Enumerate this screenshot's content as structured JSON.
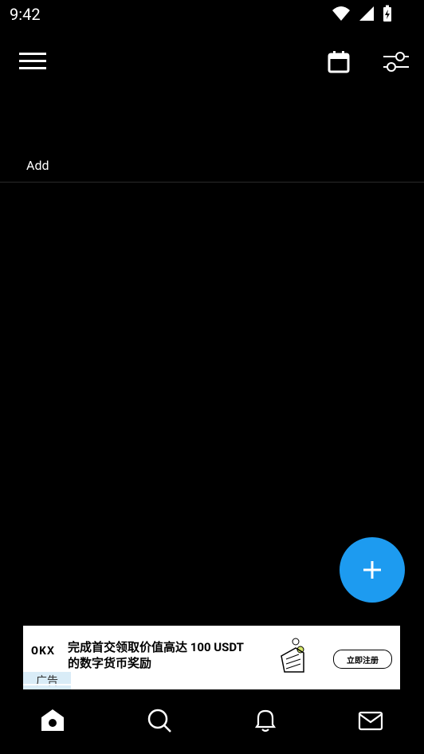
{
  "status_bar": {
    "time": "9:42",
    "icons": [
      "wifi-icon",
      "signal-icon",
      "battery-charging-icon"
    ]
  },
  "top_bar": {
    "icons": [
      "menu-icon",
      "calendar-icon",
      "filter-sliders-icon"
    ]
  },
  "list": {
    "add_label": "Add"
  },
  "fab": {
    "icon": "plus-icon",
    "color": "#1d9bf0"
  },
  "ad": {
    "logo_text": "OKX",
    "headline_line1": "完成首交领取价值高达 100 USDT",
    "headline_line2": "的数字货币奖励",
    "cta": "立即注册",
    "ad_mark": "广告"
  },
  "bottom_nav": {
    "items": [
      "home-icon",
      "search-icon",
      "notifications-bell-icon",
      "messages-mail-icon"
    ]
  },
  "colors": {
    "background": "#000000",
    "accent": "#1d9bf0",
    "text": "#ffffff"
  }
}
